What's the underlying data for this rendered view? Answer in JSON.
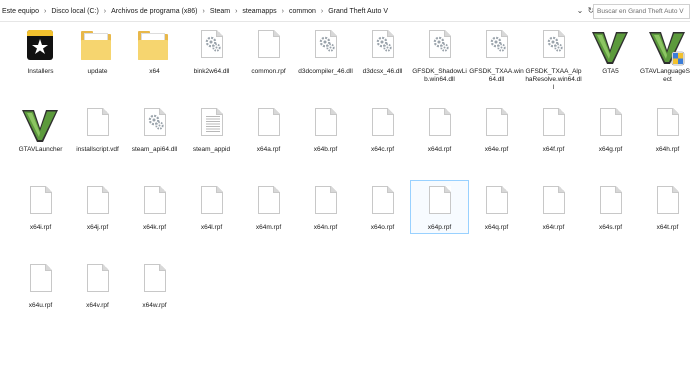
{
  "breadcrumb": [
    "Este equipo",
    "Disco local (C:)",
    "Archivos de programa (x86)",
    "Steam",
    "steamapps",
    "common",
    "Grand Theft Auto V"
  ],
  "search_placeholder": "Buscar en Grand Theft Auto V",
  "files": [
    {
      "name": "Installers",
      "icon": "installers-icon"
    },
    {
      "name": "update",
      "icon": "folder-icon"
    },
    {
      "name": "x64",
      "icon": "folder-icon"
    },
    {
      "name": "bink2w64.dll",
      "icon": "dll-gear-icon"
    },
    {
      "name": "common.rpf",
      "icon": "blank-file-icon"
    },
    {
      "name": "d3dcompiler_46.dll",
      "icon": "dll-gear-icon"
    },
    {
      "name": "d3dcsx_46.dll",
      "icon": "dll-gear-icon"
    },
    {
      "name": "GFSDK_ShadowLib.win64.dll",
      "icon": "dll-gear-icon"
    },
    {
      "name": "GFSDK_TXAA.win64.dll",
      "icon": "dll-gear-icon"
    },
    {
      "name": "GFSDK_TXAA_AlphaResolve.win64.dll",
      "icon": "dll-gear-icon"
    },
    {
      "name": "GTA5",
      "icon": "gta-v-logo-icon"
    },
    {
      "name": "GTAVLanguageSelect",
      "icon": "gta-v-shield-icon"
    },
    {
      "name": "GTAVLauncher",
      "icon": "gta-v-logo-icon"
    },
    {
      "name": "installscript.vdf",
      "icon": "blank-file-icon"
    },
    {
      "name": "steam_api64.dll",
      "icon": "dll-gear-icon"
    },
    {
      "name": "steam_appid",
      "icon": "text-file-icon"
    },
    {
      "name": "x64a.rpf",
      "icon": "blank-file-icon"
    },
    {
      "name": "x64b.rpf",
      "icon": "blank-file-icon"
    },
    {
      "name": "x64c.rpf",
      "icon": "blank-file-icon"
    },
    {
      "name": "x64d.rpf",
      "icon": "blank-file-icon"
    },
    {
      "name": "x64e.rpf",
      "icon": "blank-file-icon"
    },
    {
      "name": "x64f.rpf",
      "icon": "blank-file-icon"
    },
    {
      "name": "x64g.rpf",
      "icon": "blank-file-icon"
    },
    {
      "name": "x64h.rpf",
      "icon": "blank-file-icon"
    },
    {
      "name": "x64i.rpf",
      "icon": "blank-file-icon"
    },
    {
      "name": "x64j.rpf",
      "icon": "blank-file-icon"
    },
    {
      "name": "x64k.rpf",
      "icon": "blank-file-icon"
    },
    {
      "name": "x64l.rpf",
      "icon": "blank-file-icon"
    },
    {
      "name": "x64m.rpf",
      "icon": "blank-file-icon"
    },
    {
      "name": "x64n.rpf",
      "icon": "blank-file-icon"
    },
    {
      "name": "x64o.rpf",
      "icon": "blank-file-icon"
    },
    {
      "name": "x64p.rpf",
      "icon": "blank-file-icon",
      "selected": true
    },
    {
      "name": "x64q.rpf",
      "icon": "blank-file-icon"
    },
    {
      "name": "x64r.rpf",
      "icon": "blank-file-icon"
    },
    {
      "name": "x64s.rpf",
      "icon": "blank-file-icon"
    },
    {
      "name": "x64t.rpf",
      "icon": "blank-file-icon"
    },
    {
      "name": "x64u.rpf",
      "icon": "blank-file-icon"
    },
    {
      "name": "x64v.rpf",
      "icon": "blank-file-icon"
    },
    {
      "name": "x64w.rpf",
      "icon": "blank-file-icon"
    }
  ]
}
